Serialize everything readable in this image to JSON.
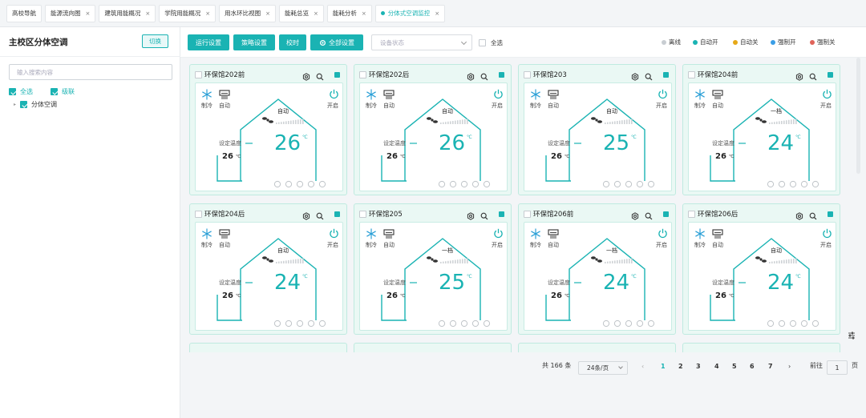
{
  "tabs": [
    {
      "label": "高校导航",
      "closable": false
    },
    {
      "label": "能源流向图",
      "closable": true
    },
    {
      "label": "建筑用能概况",
      "closable": true
    },
    {
      "label": "学院用能概况",
      "closable": true
    },
    {
      "label": "用水环比视图",
      "closable": true
    },
    {
      "label": "能耗总览",
      "closable": true
    },
    {
      "label": "能耗分析",
      "closable": true
    },
    {
      "label": "分体式空调监控",
      "closable": true,
      "active": true
    }
  ],
  "sidebar": {
    "title": "主校区分体空调",
    "switch_label": "切换",
    "search_placeholder": "输入搜索内容",
    "select_all": "全选",
    "cascade": "级联",
    "tree_root": "分体空调"
  },
  "toolbar": {
    "btn_run": "运行设置",
    "btn_strategy": "策略设置",
    "btn_calibrate": "校时",
    "btn_all": "全部设置",
    "status_placeholder": "设备状态",
    "select_all": "全选"
  },
  "legend": [
    {
      "label": "离线",
      "color": "#c8cdd2"
    },
    {
      "label": "自动开",
      "color": "#1ab3b3"
    },
    {
      "label": "自动关",
      "color": "#e6a817"
    },
    {
      "label": "强制开",
      "color": "#3a9ee6"
    },
    {
      "label": "强制关",
      "color": "#e0645a"
    }
  ],
  "cards": [
    {
      "name": "环保馆202前",
      "mode": "自动",
      "temp": "26",
      "set_temp": "26"
    },
    {
      "name": "环保馆202后",
      "mode": "自动",
      "temp": "26",
      "set_temp": "26"
    },
    {
      "name": "环保馆203",
      "mode": "自动",
      "temp": "25",
      "set_temp": "26"
    },
    {
      "name": "环保馆204前",
      "mode": "一档",
      "temp": "24",
      "set_temp": "26"
    },
    {
      "name": "环保馆204后",
      "mode": "自动",
      "temp": "24",
      "set_temp": "26"
    },
    {
      "name": "环保馆205",
      "mode": "一档",
      "temp": "25",
      "set_temp": "26"
    },
    {
      "name": "环保馆206前",
      "mode": "一档",
      "temp": "24",
      "set_temp": "26"
    },
    {
      "name": "环保馆206后",
      "mode": "自动",
      "temp": "24",
      "set_temp": "26"
    }
  ],
  "card_labels": {
    "cool": "制冷",
    "auto": "自动",
    "power": "开启",
    "set_temp_label": "设定温度",
    "unit": "℃",
    "unit_small": "℃"
  },
  "pagination": {
    "total": "共 166 条",
    "page_size": "24条/页",
    "pages": [
      "1",
      "2",
      "3",
      "4",
      "5",
      "6",
      "7"
    ],
    "current": "1",
    "goto_label": "前往",
    "goto_value": "1",
    "page_suffix": "页",
    "prev": "‹",
    "next": "›"
  },
  "colors": {
    "accent": "#1ab3b3",
    "card_bg": "#eaf8f4"
  }
}
